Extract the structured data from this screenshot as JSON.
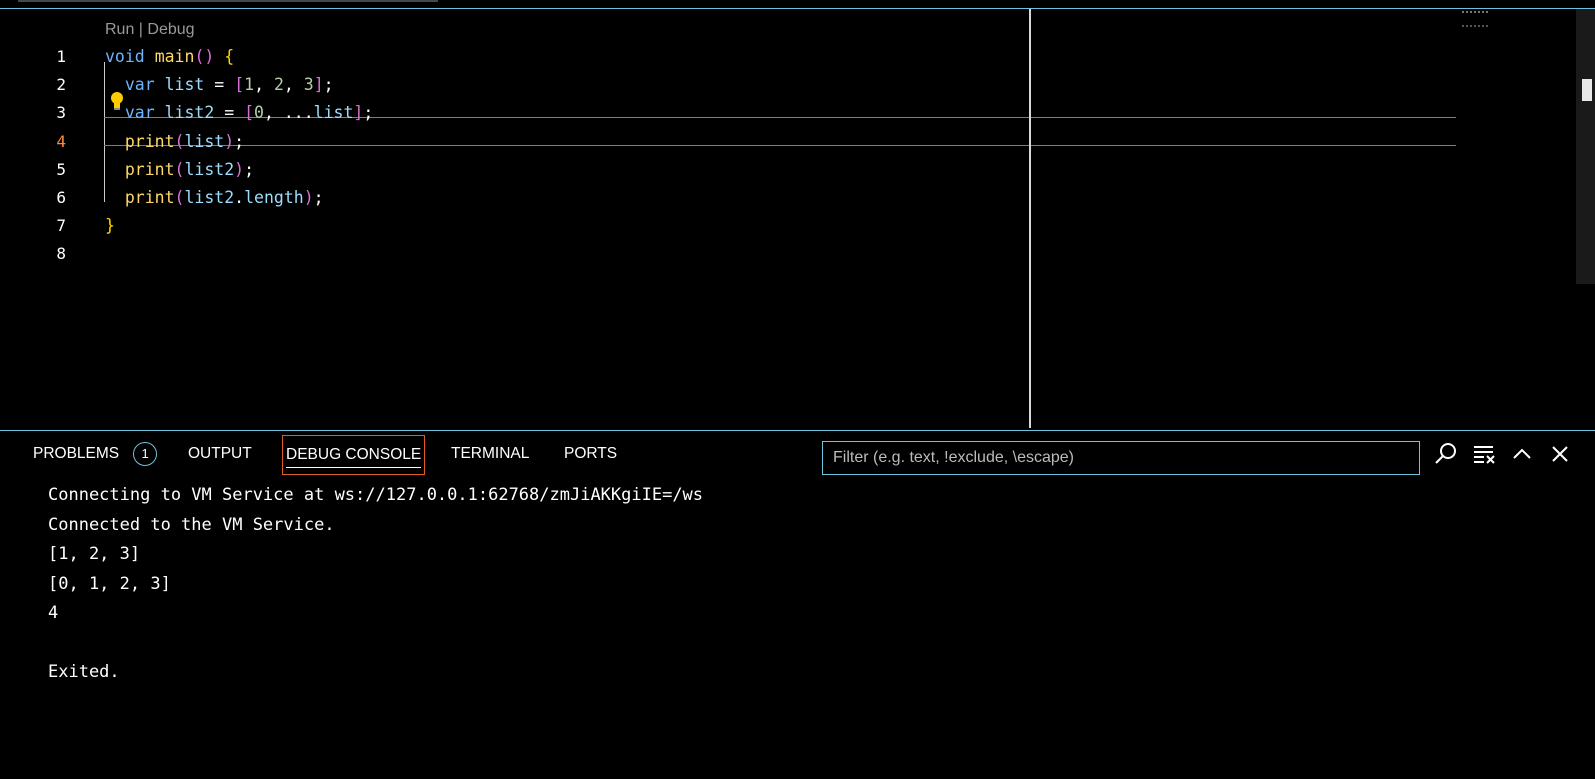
{
  "editor": {
    "codelens": {
      "run": "Run",
      "separator": " | ",
      "debug": "Debug"
    },
    "line_numbers": [
      "1",
      "2",
      "3",
      "4",
      "5",
      "6",
      "7",
      "8"
    ],
    "active_line": "4",
    "lines": [
      [
        [
          "kw",
          "void"
        ],
        [
          "op",
          " "
        ],
        [
          "fn",
          "main"
        ],
        [
          "br2",
          "()"
        ],
        [
          "op",
          " "
        ],
        [
          "br1",
          "{"
        ]
      ],
      [
        [
          "op",
          "  "
        ],
        [
          "kw",
          "var"
        ],
        [
          "op",
          " "
        ],
        [
          "id",
          "list"
        ],
        [
          "op",
          " = "
        ],
        [
          "br2",
          "["
        ],
        [
          "num",
          "1"
        ],
        [
          "op",
          ", "
        ],
        [
          "num",
          "2"
        ],
        [
          "op",
          ", "
        ],
        [
          "num",
          "3"
        ],
        [
          "br2",
          "]"
        ],
        [
          "op",
          ";"
        ]
      ],
      [
        [
          "op",
          "  "
        ],
        [
          "kw",
          "var"
        ],
        [
          "op",
          " "
        ],
        [
          "id",
          "list2"
        ],
        [
          "op",
          " = "
        ],
        [
          "br2",
          "["
        ],
        [
          "num",
          "0"
        ],
        [
          "op",
          ", ..."
        ],
        [
          "id",
          "list"
        ],
        [
          "br2",
          "]"
        ],
        [
          "op",
          ";"
        ]
      ],
      [
        [
          "op",
          "  "
        ],
        [
          "fn",
          "print"
        ],
        [
          "br2",
          "("
        ],
        [
          "id",
          "list"
        ],
        [
          "br2",
          ")"
        ],
        [
          "op",
          ";"
        ]
      ],
      [
        [
          "op",
          "  "
        ],
        [
          "fn",
          "print"
        ],
        [
          "br2",
          "("
        ],
        [
          "id",
          "list2"
        ],
        [
          "br2",
          ")"
        ],
        [
          "op",
          ";"
        ]
      ],
      [
        [
          "op",
          "  "
        ],
        [
          "fn",
          "print"
        ],
        [
          "br2",
          "("
        ],
        [
          "id",
          "list2"
        ],
        [
          "op",
          "."
        ],
        [
          "id",
          "length"
        ],
        [
          "br2",
          ")"
        ],
        [
          "op",
          ";"
        ]
      ],
      [
        [
          "br1",
          "}"
        ]
      ],
      []
    ]
  },
  "panel": {
    "tabs": [
      {
        "label": "PROBLEMS",
        "badge": "1"
      },
      {
        "label": "OUTPUT"
      },
      {
        "label": "DEBUG CONSOLE",
        "active": true
      },
      {
        "label": "TERMINAL"
      },
      {
        "label": "PORTS"
      }
    ],
    "filter": {
      "placeholder": "Filter (e.g. text, !exclude, \\escape)",
      "value": ""
    },
    "console_lines": [
      "Connecting to VM Service at ws://127.0.0.1:62768/zmJiAKKgiIE=/ws",
      "Connected to the VM Service.",
      "[1, 2, 3]",
      "[0, 1, 2, 3]",
      "4",
      "",
      "Exited."
    ]
  },
  "colors": {
    "accent_border": "#6fc3df",
    "active_outline": "#e25b22",
    "keyword": "#6cb6ff",
    "function": "#ffd866",
    "number": "#b5cea8",
    "identifier": "#9cdcfe"
  },
  "icons": [
    "lightbulb-icon",
    "search-icon",
    "clear-console-icon",
    "maximize-panel-icon",
    "close-panel-icon"
  ]
}
